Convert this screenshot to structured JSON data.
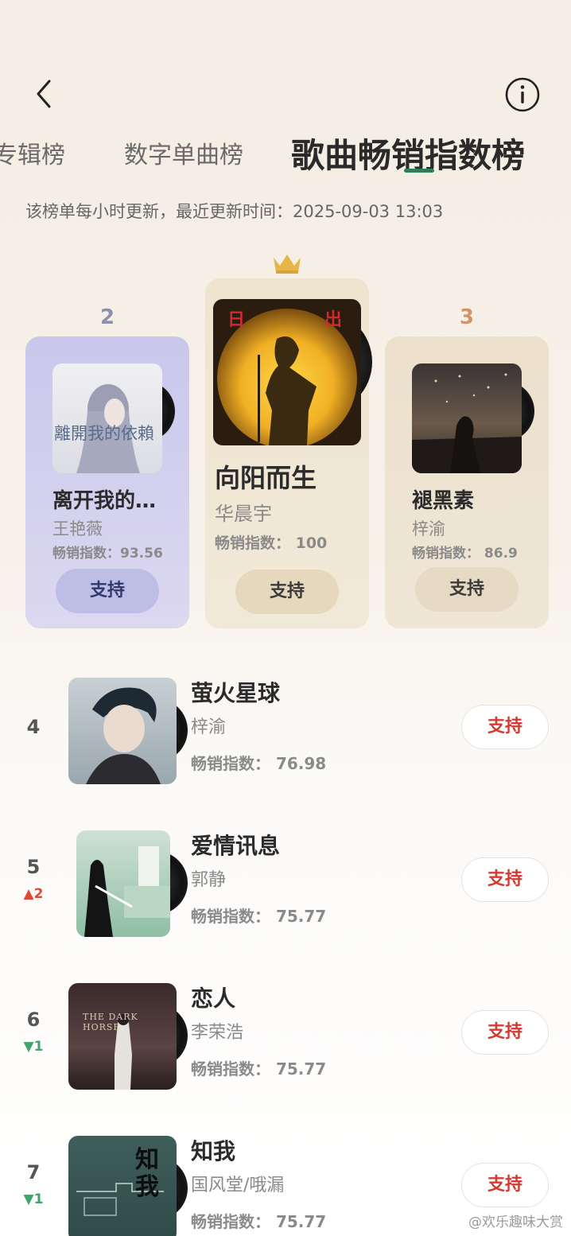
{
  "tabs": [
    {
      "label": "专辑榜"
    },
    {
      "label": "数字单曲榜"
    },
    {
      "label": "歌曲畅销指数榜"
    }
  ],
  "update_info": "该榜单每小时更新，最近更新时间：2025-09-03 13:03",
  "podium": [
    {
      "rank": "2",
      "title": "离开我的…",
      "artist": "王艳薇",
      "index_label": "畅销指数：93.56",
      "cover_text": "離開我的依賴",
      "support_label": "支持"
    },
    {
      "rank": "1",
      "title": "向阳而生",
      "artist": "华晨宇",
      "index_label": "畅销指数： 100",
      "cover_text_left": "日",
      "cover_text_right": "出",
      "support_label": "支持"
    },
    {
      "rank": "3",
      "title": "褪黑素",
      "artist": "梓渝",
      "index_label": "畅销指数： 86.9",
      "support_label": "支持"
    }
  ],
  "list": [
    {
      "rank": "4",
      "trend": "",
      "title": "萤火星球",
      "artist": "梓渝",
      "index_label": "畅销指数： 76.98",
      "support_label": "支持"
    },
    {
      "rank": "5",
      "trend": "▲2",
      "title": "爱情讯息",
      "artist": "郭静",
      "index_label": "畅销指数： 75.77",
      "support_label": "支持"
    },
    {
      "rank": "6",
      "trend": "▼1",
      "title": "恋人",
      "artist": "李荣浩",
      "index_label": "畅销指数： 75.77",
      "cover_text": "THE DARK HORSE",
      "support_label": "支持"
    },
    {
      "rank": "7",
      "trend": "▼1",
      "title": "知我",
      "artist": "国风堂/哦漏",
      "index_label": "畅销指数： 75.77",
      "cover_text": "知我",
      "support_label": "支持"
    }
  ],
  "watermark": "@欢乐趣味大赏",
  "colors": {
    "accent_green": "#2e7d5b",
    "support_red": "#d23a30",
    "trend_up": "#e0483a",
    "trend_down": "#3fa56a"
  }
}
